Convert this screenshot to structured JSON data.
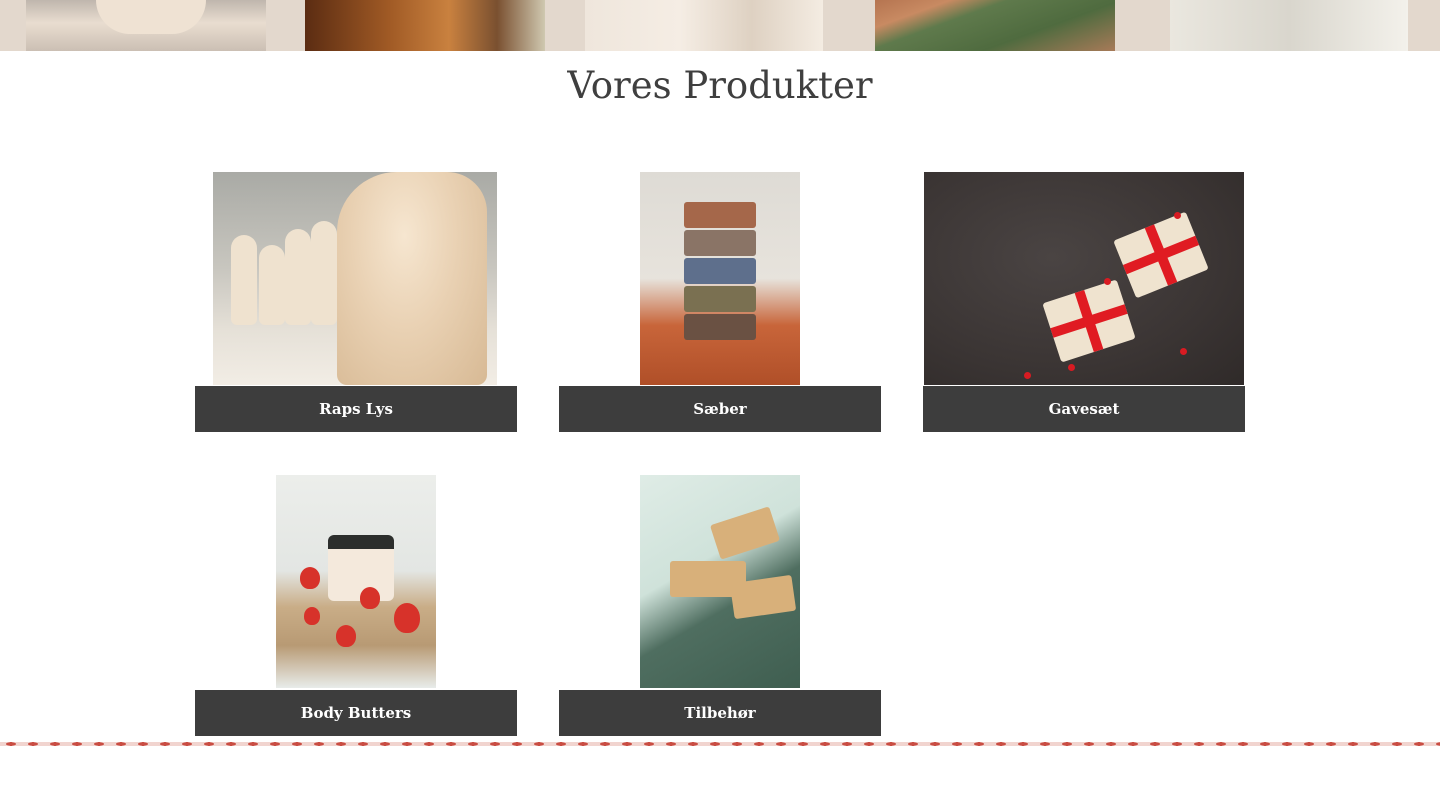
{
  "page": {
    "title": "Vores Produkter"
  },
  "products": [
    {
      "label": "Raps Lys",
      "image": "candles-photo"
    },
    {
      "label": "Sæber",
      "image": "soap-stack-photo"
    },
    {
      "label": "Gavesæt",
      "image": "gift-boxes-photo"
    },
    {
      "label": "Body Butters",
      "image": "body-butter-jar-photo"
    },
    {
      "label": "Tilbehør",
      "image": "soap-dish-photo"
    }
  ],
  "colors": {
    "label_bg": "#3d3d3d",
    "label_text": "#ffffff",
    "title_text": "#3f3f3f",
    "banner_bg": "#e3d8cd",
    "border_accent": "#c94d43"
  }
}
